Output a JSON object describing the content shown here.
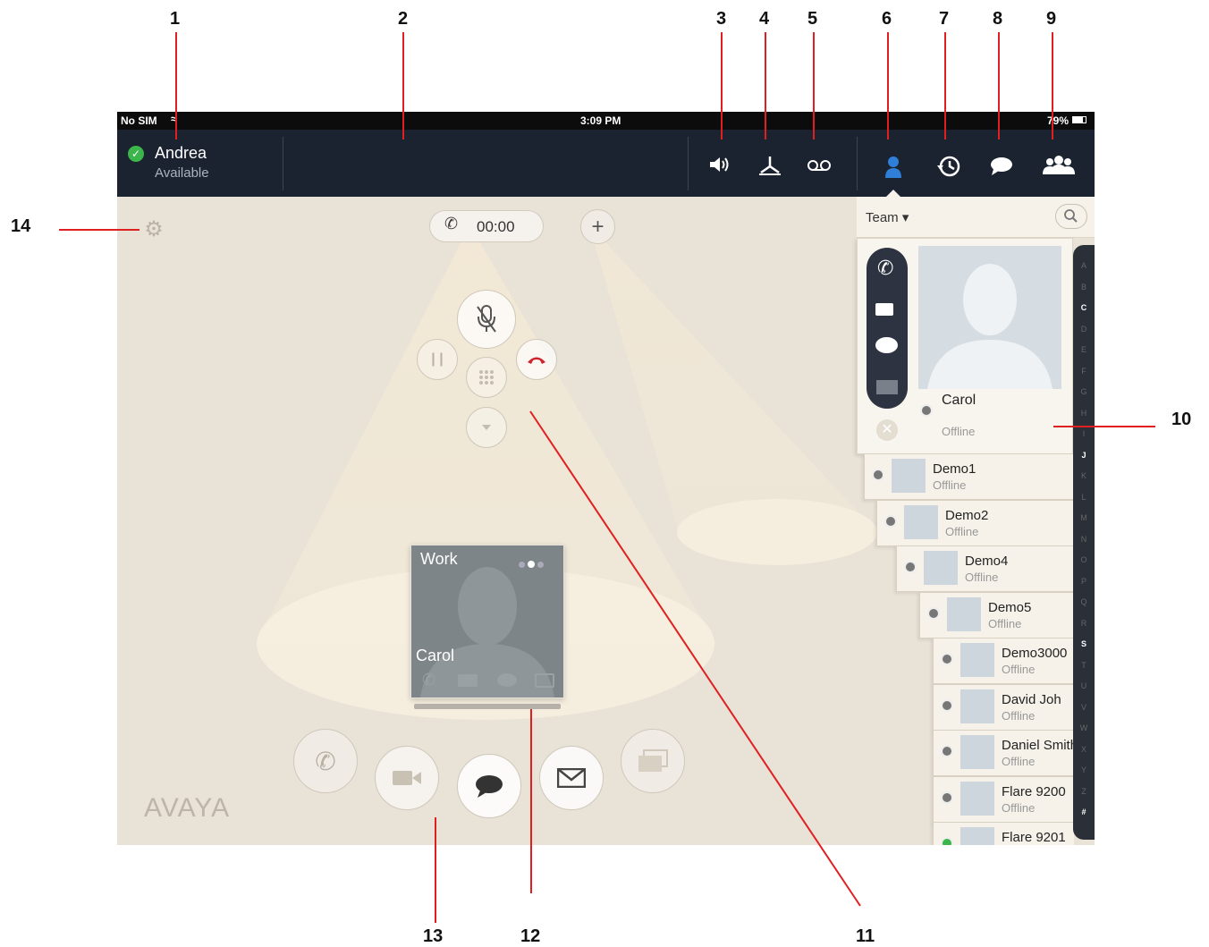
{
  "callouts": [
    "1",
    "2",
    "3",
    "4",
    "5",
    "6",
    "7",
    "8",
    "9",
    "10",
    "11",
    "12",
    "13",
    "14"
  ],
  "status_bar": {
    "carrier": "No SIM",
    "time": "3:09 PM",
    "battery": "79%"
  },
  "user": {
    "name": "Andrea",
    "status": "Available"
  },
  "call": {
    "timer": "00:00"
  },
  "contacts_panel": {
    "filter": "Team",
    "selected": {
      "name": "Carol",
      "status": "Offline"
    },
    "rows": [
      {
        "name": "Demo1",
        "status": "Offline",
        "presence": "offline"
      },
      {
        "name": "Demo2",
        "status": "Offline",
        "presence": "offline"
      },
      {
        "name": "Demo4",
        "status": "Offline",
        "presence": "offline"
      },
      {
        "name": "Demo5",
        "status": "Offline",
        "presence": "offline"
      },
      {
        "name": "Demo3000",
        "status": "Offline",
        "presence": "offline"
      },
      {
        "name": "David Joh",
        "status": "Offline",
        "presence": "offline"
      },
      {
        "name": "Daniel Smith",
        "status": "Offline",
        "presence": "offline"
      },
      {
        "name": "Flare 9200",
        "status": "Offline",
        "presence": "offline"
      },
      {
        "name": "Flare 9201",
        "status": "",
        "presence": "available"
      }
    ],
    "alphabet": [
      "A",
      "B",
      "C",
      "D",
      "E",
      "F",
      "G",
      "H",
      "I",
      "J",
      "K",
      "L",
      "M",
      "N",
      "O",
      "P",
      "Q",
      "R",
      "S",
      "T",
      "U",
      "V",
      "W",
      "X",
      "Y",
      "Z",
      "#"
    ]
  },
  "contact_card": {
    "label": "Work",
    "name": "Carol"
  },
  "brand": "AVAYA",
  "colors": {
    "accent_blue": "#2f7fd8",
    "available_green": "#3cb54a",
    "end_call_red": "#d0222a",
    "leader_red": "#e02020"
  },
  "icons": [
    "wifi-icon",
    "battery-icon",
    "available-check-icon",
    "speaker-icon",
    "transfer-icon",
    "voicemail-icon",
    "contacts-icon",
    "history-icon",
    "messages-icon",
    "groups-icon",
    "search-icon",
    "settings-gear-icon",
    "add-icon",
    "mute-icon",
    "hold-icon",
    "dialpad-icon",
    "end-call-icon",
    "more-icon",
    "phone-icon",
    "video-icon",
    "chat-icon",
    "email-icon",
    "share-screen-icon",
    "close-icon"
  ]
}
